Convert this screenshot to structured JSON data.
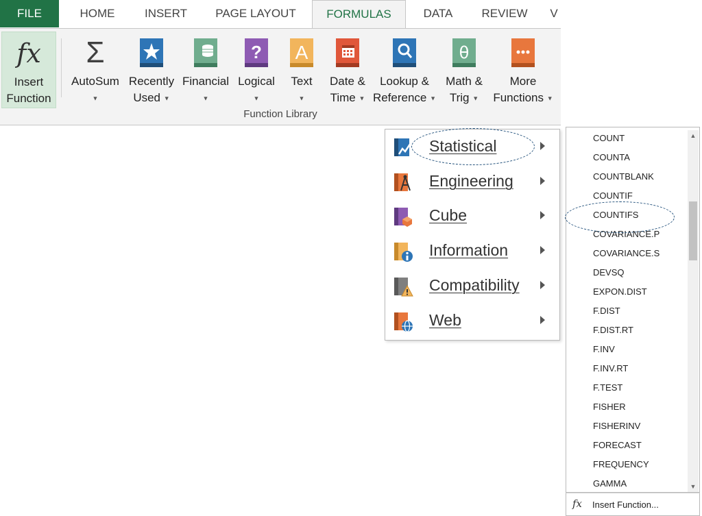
{
  "tabs": [
    "FILE",
    "HOME",
    "INSERT",
    "PAGE LAYOUT",
    "FORMULAS",
    "DATA",
    "REVIEW",
    "V"
  ],
  "ribbon": {
    "insert_function": {
      "line1": "Insert",
      "line2": "Function",
      "icon_text": "fx"
    },
    "autosum": {
      "line1": "AutoSum",
      "icon_text": "Σ"
    },
    "recently_used": {
      "line1": "Recently",
      "line2": "Used"
    },
    "financial": {
      "line1": "Financial"
    },
    "logical": {
      "line1": "Logical"
    },
    "text": {
      "line1": "Text"
    },
    "date_time": {
      "line1": "Date &",
      "line2": "Time"
    },
    "lookup": {
      "line1": "Lookup &",
      "line2": "Reference"
    },
    "math": {
      "line1": "Math &",
      "line2": "Trig"
    },
    "more": {
      "line1": "More",
      "line2": "Functions"
    },
    "group_label": "Function Library"
  },
  "submenu": [
    "Statistical",
    "Engineering",
    "Cube",
    "Information",
    "Compatibility",
    "Web"
  ],
  "functions": [
    "COUNT",
    "COUNTA",
    "COUNTBLANK",
    "COUNTIF",
    "COUNTIFS",
    "COVARIANCE.P",
    "COVARIANCE.S",
    "DEVSQ",
    "EXPON.DIST",
    "F.DIST",
    "F.DIST.RT",
    "F.INV",
    "F.INV.RT",
    "F.TEST",
    "FISHER",
    "FISHERINV",
    "FORECAST",
    "FREQUENCY",
    "GAMMA"
  ],
  "footer": {
    "icon": "fx",
    "label": "Insert Function..."
  },
  "colors": {
    "accent": "#217346",
    "annotation": "#1f4e79"
  }
}
